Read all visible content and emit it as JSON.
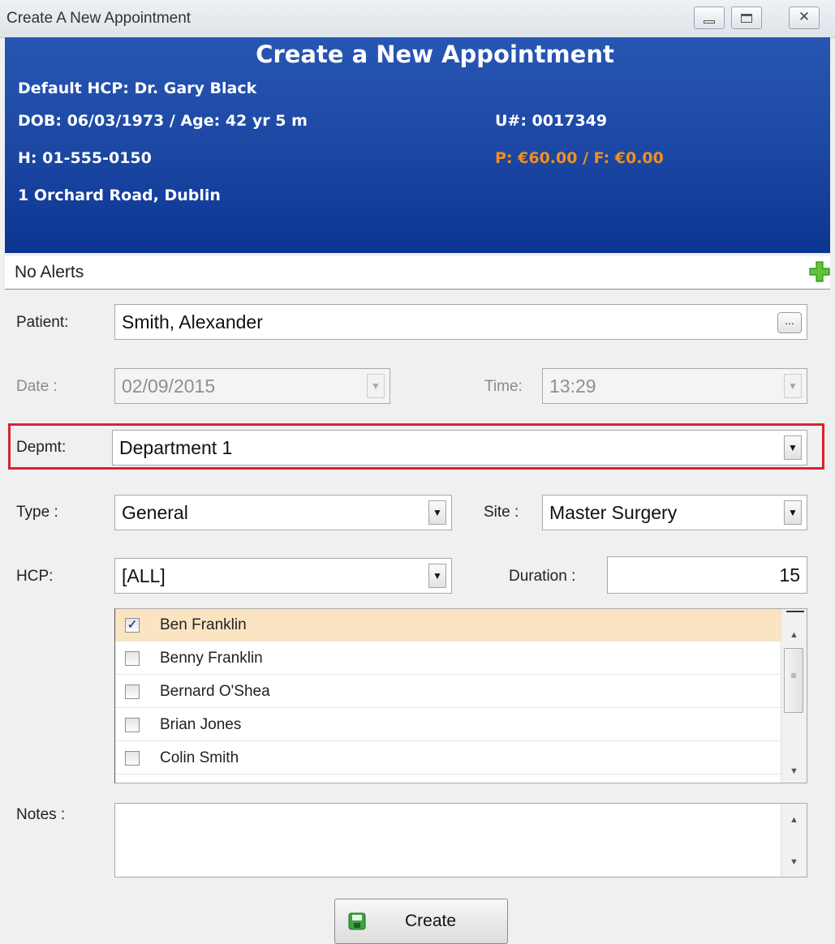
{
  "window": {
    "title": "Create A New Appointment"
  },
  "header": {
    "title": "Create a New Appointment",
    "default_hcp": "Default HCP: Dr. Gary Black",
    "dob": "DOB: 06/03/1973 / Age: 42 yr 5 m",
    "unumber": "U#: 0017349",
    "phone": "H: 01-555-0150",
    "balance": "P: €60.00 / F: €0.00",
    "address": "1 Orchard Road, Dublin",
    "balance_color": "#f0901e"
  },
  "alerts": {
    "label": "No Alerts"
  },
  "form": {
    "patient_label": "Patient:",
    "patient_value": "Smith, Alexander",
    "browse_label": "...",
    "date_label": "Date :",
    "date_value": "02/09/2015",
    "time_label": "Time:",
    "time_value": "13:29",
    "dept_label": "Depmt:",
    "dept_value": "Department 1",
    "type_label": "Type :",
    "type_value": "General",
    "site_label": "Site :",
    "site_value": "Master Surgery",
    "hcp_label": "HCP:",
    "hcp_value": "[ALL]",
    "duration_label": "Duration :",
    "duration_value": "15",
    "notes_label": "Notes :",
    "notes_value": "",
    "highlight_color": "#d9232e"
  },
  "hcp_list": [
    {
      "name": "Ben Franklin",
      "checked": true
    },
    {
      "name": "Benny Franklin",
      "checked": false
    },
    {
      "name": "Bernard O'Shea",
      "checked": false
    },
    {
      "name": "Brian Jones",
      "checked": false
    },
    {
      "name": "Colin Smith",
      "checked": false
    }
  ],
  "actions": {
    "create_label": "Create"
  }
}
